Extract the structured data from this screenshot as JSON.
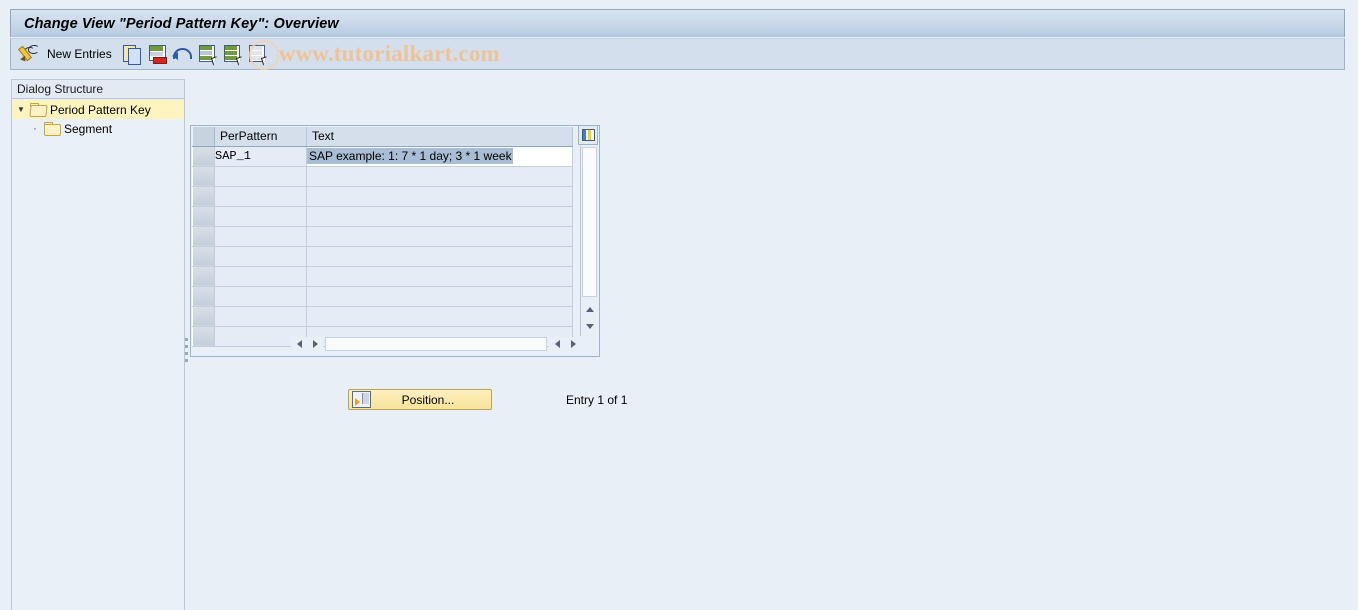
{
  "window": {
    "title": "Change View \"Period Pattern Key\": Overview"
  },
  "toolbar": {
    "edit_icon": "pencil-icon",
    "new_entries_label": "New Entries",
    "buttons": [
      {
        "name": "copy-as-button",
        "icon": "copy-icon"
      },
      {
        "name": "delete-button",
        "icon": "delete-row-icon"
      },
      {
        "name": "undo-button",
        "icon": "undo-icon"
      },
      {
        "name": "select-all-button",
        "icon": "select-all-icon"
      },
      {
        "name": "deselect-all-button",
        "icon": "deselect-all-icon"
      },
      {
        "name": "select-block-button",
        "icon": "select-block-icon"
      }
    ],
    "watermark": "www.tutorialkart.com"
  },
  "sidebar": {
    "header": "Dialog Structure",
    "items": [
      {
        "label": "Period Pattern Key",
        "icon": "open-folder-icon",
        "selected": true,
        "expanded": true,
        "level": 0
      },
      {
        "label": "Segment",
        "icon": "folder-icon",
        "selected": false,
        "expanded": false,
        "level": 1
      }
    ]
  },
  "table": {
    "settings_icon": "table-settings-icon",
    "columns": [
      {
        "key": "perpattern",
        "label": "PerPattern"
      },
      {
        "key": "text",
        "label": "Text"
      }
    ],
    "rows": [
      {
        "perpattern": "SAP_1",
        "text": "SAP example: 1: 7 * 1 day; 3 * 1 week",
        "text_selected": true
      }
    ],
    "empty_row_count": 9
  },
  "footer": {
    "position_button_label": "Position...",
    "position_button_icon": "position-icon",
    "entry_count": "Entry 1 of 1"
  },
  "colors": {
    "background": "#e9eff7",
    "titlebar": "#bed0e3",
    "toolbar": "#d3dfec",
    "selected_tree_row": "#fdf3bf",
    "selected_text": "#a9bdd4",
    "position_button": "#f7e39a",
    "watermark": "#f0c396"
  }
}
